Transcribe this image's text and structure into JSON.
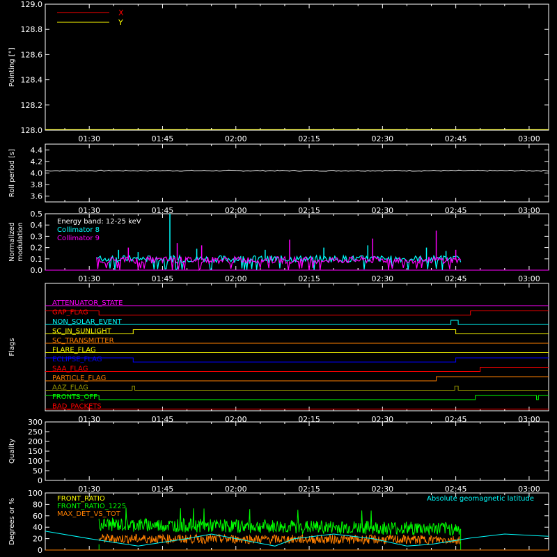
{
  "time_axis": {
    "ticks": [
      "01:30",
      "01:45",
      "02:00",
      "02:15",
      "02:30",
      "02:45",
      "03:00"
    ],
    "range_minutes": [
      81,
      184
    ]
  },
  "chart_data": [
    {
      "type": "line",
      "ylabel": "Pointing [°]",
      "ylim": [
        128.0,
        129.0
      ],
      "yticks": [
        "128.0",
        "128.2",
        "128.4",
        "128.6",
        "128.8",
        "129.0"
      ],
      "legend": [
        {
          "name": "X",
          "color": "#ff0000"
        },
        {
          "name": "Y",
          "color": "#ffff00"
        }
      ],
      "series": [
        {
          "name": "X",
          "color": "#ff0000",
          "x": [],
          "y": []
        },
        {
          "name": "Y",
          "color": "#ffff00",
          "x": [],
          "y": []
        }
      ]
    },
    {
      "type": "line",
      "ylabel": "Roll period [s]",
      "ylim": [
        3.5,
        4.5
      ],
      "yticks": [
        "3.6",
        "3.8",
        "4.0",
        "4.2",
        "4.4"
      ],
      "series": [
        {
          "color": "#ffffff",
          "x": [
            81,
            100,
            120,
            140,
            160,
            180,
            184
          ],
          "y": [
            4.04,
            4.04,
            4.04,
            4.04,
            4.04,
            4.04,
            4.04
          ]
        }
      ]
    },
    {
      "type": "line",
      "ylabel": [
        "Normalized",
        "modulation"
      ],
      "ylim": [
        0,
        0.5
      ],
      "yticks": [
        "0.0",
        "0.1",
        "0.2",
        "0.3",
        "0.4",
        "0.5"
      ],
      "annotation": "Energy band: 12-25 keV",
      "legend": [
        {
          "name": "Collimator 8",
          "color": "#00ffff"
        },
        {
          "name": "Collimator 9",
          "color": "#ff00ff"
        }
      ],
      "active_range": [
        91.5,
        166.0
      ],
      "series": [
        {
          "name": "Collimator 8",
          "color": "#00ffff",
          "baseline": 0.1,
          "spikes": [
            {
              "x": 96,
              "y": 0.18
            },
            {
              "x": 100,
              "y": 0.16
            },
            {
              "x": 106.5,
              "y": 0.52
            },
            {
              "x": 112,
              "y": 0.19
            },
            {
              "x": 126,
              "y": 0.18
            },
            {
              "x": 138,
              "y": 0.2
            },
            {
              "x": 147,
              "y": 0.22
            },
            {
              "x": 159,
              "y": 0.2
            },
            {
              "x": 163,
              "y": 0.17
            }
          ]
        },
        {
          "name": "Collimator 9",
          "color": "#ff00ff",
          "baseline": 0.09,
          "spikes": [
            {
              "x": 98,
              "y": 0.2
            },
            {
              "x": 108,
              "y": 0.24
            },
            {
              "x": 113,
              "y": 0.22
            },
            {
              "x": 131,
              "y": 0.27
            },
            {
              "x": 148,
              "y": 0.28
            },
            {
              "x": 161,
              "y": 0.35
            },
            {
              "x": 165,
              "y": 0.18
            }
          ]
        }
      ]
    },
    {
      "type": "line",
      "ylabel": "Flags",
      "flags": [
        {
          "name": "ATTENUATOR_STATE",
          "color": "#ff00ff",
          "steps": [
            [
              81,
              0
            ],
            [
              184,
              0
            ]
          ]
        },
        {
          "name": "GAP_FLAG",
          "color": "#ff0000",
          "steps": [
            [
              81,
              1
            ],
            [
              92,
              0
            ],
            [
              168,
              1
            ],
            [
              184,
              1
            ]
          ]
        },
        {
          "name": "NON_SOLAR_EVENT",
          "color": "#00ffff",
          "steps": [
            [
              81,
              0
            ],
            [
              164,
              1
            ],
            [
              165.5,
              0
            ],
            [
              184,
              0
            ]
          ]
        },
        {
          "name": "SC_IN_SUNLIGHT",
          "color": "#ffff00",
          "steps": [
            [
              81,
              0
            ],
            [
              99,
              1
            ],
            [
              165,
              0
            ],
            [
              184,
              0
            ]
          ]
        },
        {
          "name": "SC_TRANSMITTER",
          "color": "#ff7f00",
          "steps": [
            [
              81,
              0
            ],
            [
              184,
              0
            ]
          ]
        },
        {
          "name": "FLARE_FLAG",
          "color": "#ffff00",
          "steps": [
            [
              81,
              0
            ],
            [
              184,
              0
            ]
          ]
        },
        {
          "name": "ECLIPSE_FLAG",
          "color": "#0000ff",
          "steps": [
            [
              81,
              1
            ],
            [
              99,
              0
            ],
            [
              165,
              1
            ],
            [
              184,
              1
            ]
          ]
        },
        {
          "name": "SAA_FLAG",
          "color": "#ff0000",
          "steps": [
            [
              81,
              0
            ],
            [
              170,
              1
            ],
            [
              184,
              1
            ]
          ]
        },
        {
          "name": "PARTICLE_FLAG",
          "color": "#ff7f00",
          "steps": [
            [
              81,
              0
            ],
            [
              161,
              1
            ],
            [
              184,
              1
            ]
          ]
        },
        {
          "name": "AAZ_FLAG",
          "color": "#999900",
          "steps": [
            [
              81,
              0
            ],
            [
              98.8,
              1
            ],
            [
              99.3,
              0
            ],
            [
              164.8,
              1
            ],
            [
              165.5,
              0
            ],
            [
              184,
              0
            ]
          ]
        },
        {
          "name": "FRONTS_OFF",
          "color": "#00ff00",
          "steps": [
            [
              81,
              1
            ],
            [
              92,
              0
            ],
            [
              169,
              1
            ],
            [
              181.5,
              0
            ],
            [
              181.9,
              1
            ],
            [
              184,
              1
            ]
          ]
        },
        {
          "name": "BAD_PACKETS",
          "color": "#ff0000",
          "steps": [
            [
              81,
              0
            ],
            [
              184,
              0
            ]
          ]
        }
      ]
    },
    {
      "type": "line",
      "ylabel": "Quality",
      "ylim": [
        0,
        300
      ],
      "yticks": [
        "0",
        "50",
        "100",
        "150",
        "200",
        "250",
        "300"
      ],
      "series": [
        {
          "color": "#ffffff",
          "x": [
            81,
            184
          ],
          "y": [
            0,
            0
          ]
        }
      ]
    },
    {
      "type": "line",
      "ylabel": "Degrees or %",
      "ylim": [
        0,
        100
      ],
      "yticks": [
        "0",
        "20",
        "40",
        "60",
        "80",
        "100"
      ],
      "annotation": "Absolute geomagnetic latitude",
      "legend": [
        {
          "name": "FRONT_RATIO",
          "color": "#ffff00"
        },
        {
          "name": "FRONT_RATIO_1225",
          "color": "#00ff00"
        },
        {
          "name": "MAX_DET_VS_TOT",
          "color": "#ff7f00"
        }
      ],
      "active_range": [
        92,
        166
      ],
      "series": [
        {
          "name": "FRONT_RATIO_1225",
          "color": "#00ff00",
          "start": 45,
          "end": 37
        },
        {
          "name": "MAX_DET_VS_TOT",
          "color": "#ff7f00",
          "start": 20,
          "end": 18
        },
        {
          "name": "Absolute geomagnetic latitude",
          "color": "#00ffff",
          "x": [
            81,
            90,
            100,
            110,
            115,
            120,
            128,
            132,
            140,
            148,
            155,
            160,
            168,
            175,
            184
          ],
          "y": [
            33,
            20,
            7,
            20,
            28,
            20,
            7,
            20,
            28,
            20,
            7,
            10,
            21,
            28,
            24
          ]
        }
      ]
    }
  ]
}
